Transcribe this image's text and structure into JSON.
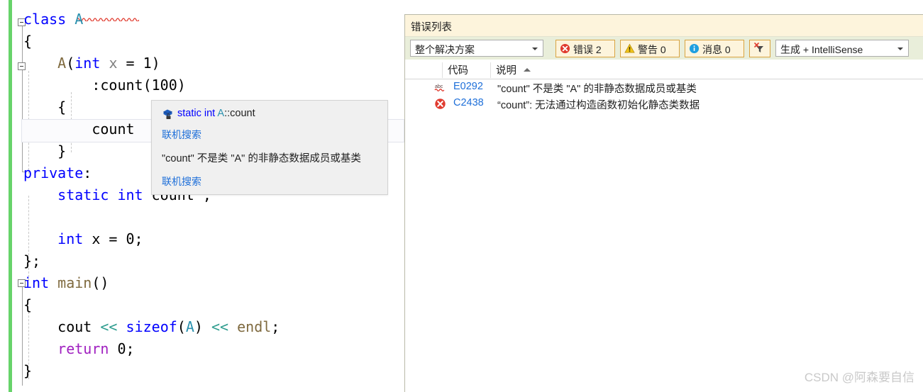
{
  "editor": {
    "language": "cpp",
    "lines": [
      {
        "indent": 0,
        "fold": true,
        "tokens": [
          {
            "t": "class",
            "c": "kw"
          },
          {
            "t": " ",
            "c": "plain"
          },
          {
            "t": "A",
            "c": "type"
          }
        ]
      },
      {
        "indent": 0,
        "fold": false,
        "tokens": [
          {
            "t": "{",
            "c": "plain"
          }
        ]
      },
      {
        "indent": 1,
        "fold": true,
        "tokens": [
          {
            "t": "A",
            "c": "ctor"
          },
          {
            "t": "(",
            "c": "plain"
          },
          {
            "t": "int",
            "c": "kw"
          },
          {
            "t": " ",
            "c": "plain"
          },
          {
            "t": "x",
            "c": "param"
          },
          {
            "t": " = 1)",
            "c": "plain"
          }
        ]
      },
      {
        "indent": 2,
        "fold": false,
        "tokens": [
          {
            "t": ":count(100)",
            "c": "plain"
          }
        ]
      },
      {
        "indent": 1,
        "fold": false,
        "tokens": [
          {
            "t": "{",
            "c": "plain"
          }
        ]
      },
      {
        "indent": 2,
        "fold": false,
        "tokens": [
          {
            "t": "count",
            "c": "plain"
          }
        ]
      },
      {
        "indent": 1,
        "fold": false,
        "tokens": [
          {
            "t": "}",
            "c": "plain"
          }
        ]
      },
      {
        "indent": 0,
        "fold": false,
        "tokens": [
          {
            "t": "private",
            "c": "kw"
          },
          {
            "t": ":",
            "c": "plain"
          }
        ]
      },
      {
        "indent": 1,
        "fold": false,
        "tokens": [
          {
            "t": "static",
            "c": "kw"
          },
          {
            "t": " ",
            "c": "plain"
          },
          {
            "t": "int",
            "c": "kw"
          },
          {
            "t": " ",
            "c": "plain"
          },
          {
            "t": "count",
            "c": "plain"
          },
          {
            "t": " ;",
            "c": "plain"
          }
        ]
      },
      {
        "indent": 0,
        "fold": false,
        "tokens": [
          {
            "t": "",
            "c": "plain"
          }
        ]
      },
      {
        "indent": 1,
        "fold": false,
        "tokens": [
          {
            "t": "int",
            "c": "kw"
          },
          {
            "t": " ",
            "c": "plain"
          },
          {
            "t": "x",
            "c": "plain"
          },
          {
            "t": " = 0;",
            "c": "plain"
          }
        ]
      },
      {
        "indent": 0,
        "fold": false,
        "tokens": [
          {
            "t": "};",
            "c": "plain"
          }
        ]
      },
      {
        "indent": 0,
        "fold": true,
        "tokens": [
          {
            "t": "int",
            "c": "kw"
          },
          {
            "t": " ",
            "c": "plain"
          },
          {
            "t": "main",
            "c": "ctor"
          },
          {
            "t": "()",
            "c": "plain"
          }
        ]
      },
      {
        "indent": 0,
        "fold": false,
        "tokens": [
          {
            "t": "{",
            "c": "plain"
          }
        ]
      },
      {
        "indent": 1,
        "fold": false,
        "tokens": [
          {
            "t": "cout",
            "c": "plain"
          },
          {
            "t": " ",
            "c": "plain"
          },
          {
            "t": "<<",
            "c": "op"
          },
          {
            "t": " ",
            "c": "plain"
          },
          {
            "t": "sizeof",
            "c": "kw"
          },
          {
            "t": "(",
            "c": "plain"
          },
          {
            "t": "A",
            "c": "type"
          },
          {
            "t": ") ",
            "c": "plain"
          },
          {
            "t": "<<",
            "c": "op"
          },
          {
            "t": " ",
            "c": "plain"
          },
          {
            "t": "endl",
            "c": "ctor"
          },
          {
            "t": ";",
            "c": "plain"
          }
        ]
      },
      {
        "indent": 1,
        "fold": false,
        "tokens": [
          {
            "t": "return",
            "c": "ret"
          },
          {
            "t": " 0;",
            "c": "plain"
          }
        ]
      },
      {
        "indent": 0,
        "fold": false,
        "tokens": [
          {
            "t": "}",
            "c": "plain"
          }
        ]
      }
    ]
  },
  "tooltip": {
    "icon_name": "field-member-icon",
    "signature_parts": [
      {
        "text": "static int ",
        "color": "#0000ff"
      },
      {
        "text": "A",
        "color": "#2b91af"
      },
      {
        "text": "::count",
        "color": "#1f1f1f"
      }
    ],
    "signature": "static int A::count",
    "link_1": "联机搜索",
    "description": "\"count\" 不是类 \"A\" 的非静态数据成员或基类",
    "link_2": "联机搜索"
  },
  "error_list": {
    "title": "错误列表",
    "scope_selected": "整个解决方案",
    "build_selected": "生成 + IntelliSense",
    "severity_buttons": [
      {
        "icon": "error-circle-icon",
        "label": "错误 2",
        "color": "#e03b2f"
      },
      {
        "icon": "warning-triangle-icon",
        "label": "警告 0",
        "color": "#f0c419"
      },
      {
        "icon": "info-circle-icon",
        "label": "消息 0",
        "color": "#1e9fe0"
      }
    ],
    "filter_button_icon": "clear-filter-icon",
    "columns": [
      {
        "key": "severity",
        "label": ""
      },
      {
        "key": "code",
        "label": "代码"
      },
      {
        "key": "description",
        "label": "说明",
        "sorted": "asc"
      }
    ],
    "rows": [
      {
        "icon": "intellisense-squiggle-icon",
        "code": "E0292",
        "description": "\"count\" 不是类 \"A\" 的非静态数据成员或基类"
      },
      {
        "icon": "error-circle-icon",
        "code": "C2438",
        "description": "“count”: 无法通过构造函数初始化静态类数据"
      }
    ]
  },
  "watermark": "CSDN @阿森要自信",
  "colors": {
    "change_bar_green": "#67d36a",
    "keyword_blue": "#0000ff",
    "type_teal": "#2b91af",
    "ctor_olive": "#7f6a3f",
    "operator_teal": "#2f9d8f",
    "return_purple": "#a020c0",
    "param_gray": "#808080",
    "panel_title_bg": "#fdf4dc",
    "toolbar_bg": "#e9eeda",
    "link_blue": "#1e6fd9",
    "error_red": "#e03b2f",
    "warning_yellow": "#f0c419",
    "info_blue": "#1e9fe0"
  }
}
